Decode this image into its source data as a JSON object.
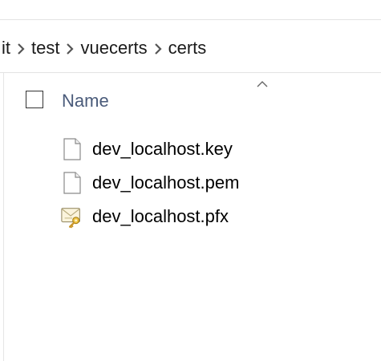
{
  "breadcrumb": {
    "items": [
      "it",
      "test",
      "vuecerts",
      "certs"
    ]
  },
  "header": {
    "column_name": "Name",
    "sort_icon": "chevron-up-icon"
  },
  "files": [
    {
      "name": "dev_localhost.key",
      "icon": "blank-file-icon"
    },
    {
      "name": "dev_localhost.pem",
      "icon": "blank-file-icon"
    },
    {
      "name": "dev_localhost.pfx",
      "icon": "certificate-file-icon"
    }
  ],
  "colors": {
    "header_text": "#4a5b7a",
    "border": "#e3e3e3"
  }
}
